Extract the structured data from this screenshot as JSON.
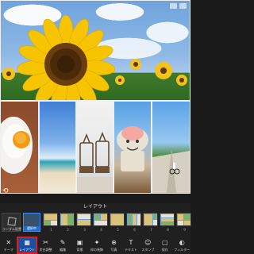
{
  "panel": {
    "title": "レイアウト",
    "random_label": "ランダム配置",
    "selected_label": "選択中"
  },
  "thumbs": [
    {
      "num": "1"
    },
    {
      "num": "2"
    },
    {
      "num": "3"
    },
    {
      "num": "4"
    },
    {
      "num": "5"
    },
    {
      "num": "6"
    },
    {
      "num": "7"
    },
    {
      "num": "8"
    },
    {
      "num": "9"
    }
  ],
  "toolbar": [
    {
      "icon": "✕",
      "label": "テーマ",
      "name": "theme"
    },
    {
      "icon": "▦",
      "label": "レイアウト",
      "name": "layout"
    },
    {
      "icon": "✂",
      "label": "余白調整",
      "name": "margin"
    },
    {
      "icon": "✎",
      "label": "編集",
      "name": "edit"
    },
    {
      "icon": "▣",
      "label": "背景",
      "name": "background"
    },
    {
      "icon": "✦",
      "label": "枠の装飾",
      "name": "frame"
    },
    {
      "icon": "⊕",
      "label": "写真",
      "name": "photo"
    },
    {
      "icon": "T",
      "label": "テキスト",
      "name": "text"
    },
    {
      "icon": "☺",
      "label": "スタンプ",
      "name": "stamp"
    },
    {
      "icon": "▢",
      "label": "保存",
      "name": "save"
    },
    {
      "icon": "◐",
      "label": "フィルター",
      "name": "filter"
    }
  ],
  "colors": {
    "active_border": "#e21b1b",
    "active_bg": "#1b4fa0",
    "selected_accent": "#3d8bff"
  }
}
